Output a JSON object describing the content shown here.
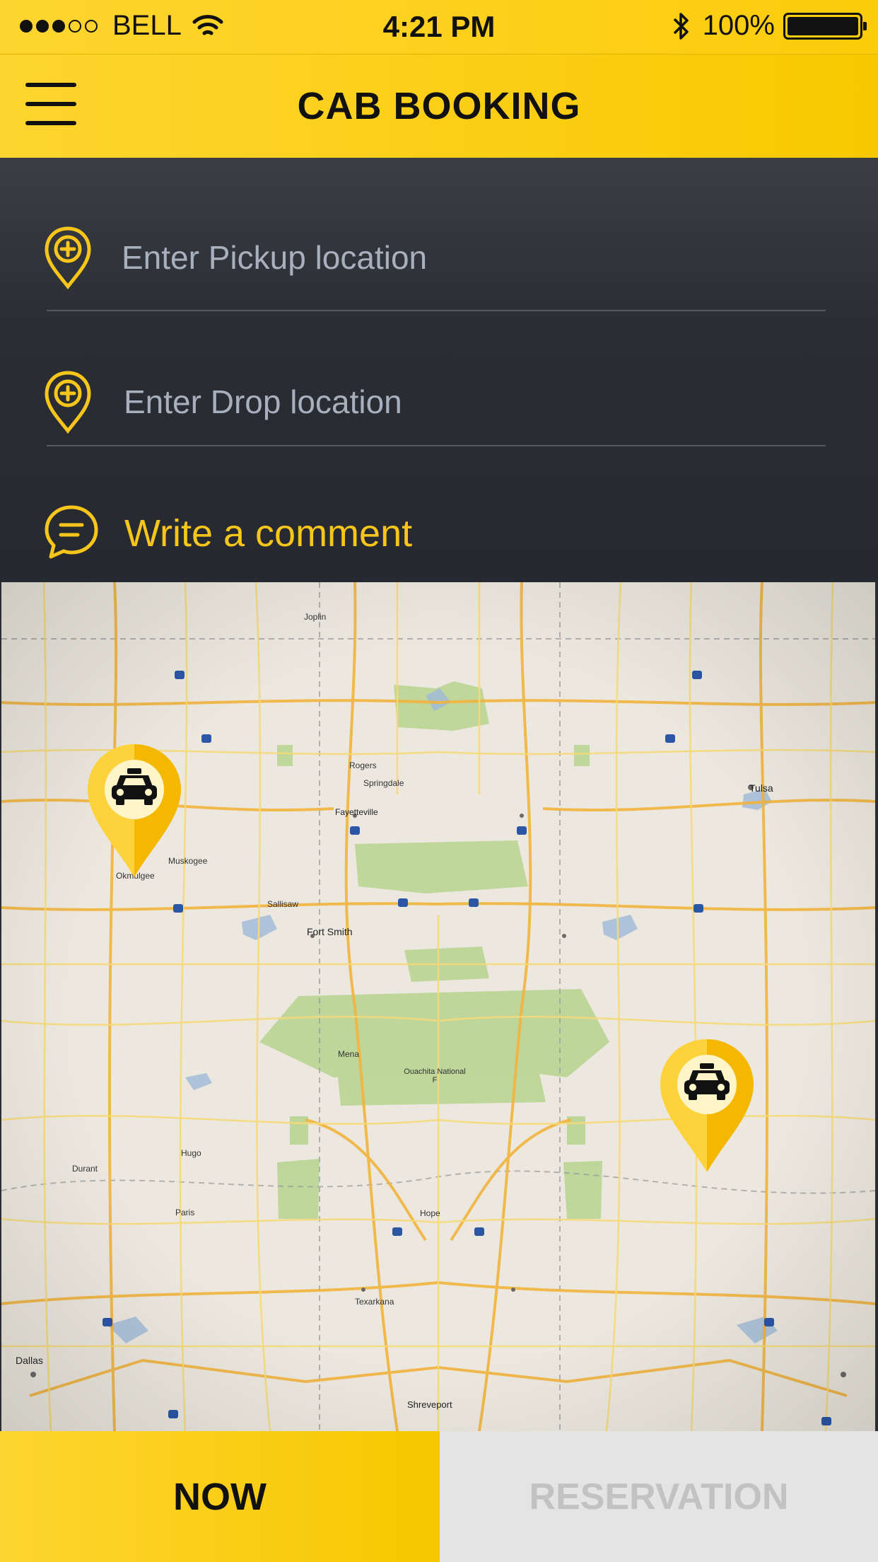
{
  "status_bar": {
    "carrier": "BELL",
    "time": "4:21 PM",
    "battery": "100%",
    "signal_bars": 3
  },
  "header": {
    "title": "CAB BOOKING",
    "menu_icon": "hamburger-menu-icon"
  },
  "form": {
    "pickup_placeholder": "Enter Pickup location",
    "drop_placeholder": "Enter Drop location",
    "comment_placeholder": "Write a comment",
    "pin_icon": "location-pin-plus-icon",
    "comment_icon": "speech-bubble-icon"
  },
  "map": {
    "labels": {
      "fort_smith": "Fort Smith",
      "fayetteville": "Fayetteville",
      "springdale": "Springdale",
      "rogers": "Rogers",
      "muskogee": "Muskogee",
      "okmulgee": "Okmulgee",
      "tulsa": "Tulsa",
      "sallisaw": "Sallisaw",
      "texarkana": "Texarkana",
      "hope": "Hope",
      "dallas": "Dallas",
      "shreveport": "Shreveport",
      "durant": "Durant",
      "paris": "Paris",
      "hugo": "Hugo",
      "mena": "Mena",
      "joplin": "Joplin",
      "ouachita": "Ouachita National F"
    },
    "taxi_icon": "taxi-icon"
  },
  "footer": {
    "now_label": "NOW",
    "reservation_label": "RESERVATION"
  },
  "colors": {
    "accent": "#fbcf15",
    "dark": "#2a2d34",
    "placeholder": "#a8b0bd",
    "muted_button": "#c2c2c2"
  }
}
